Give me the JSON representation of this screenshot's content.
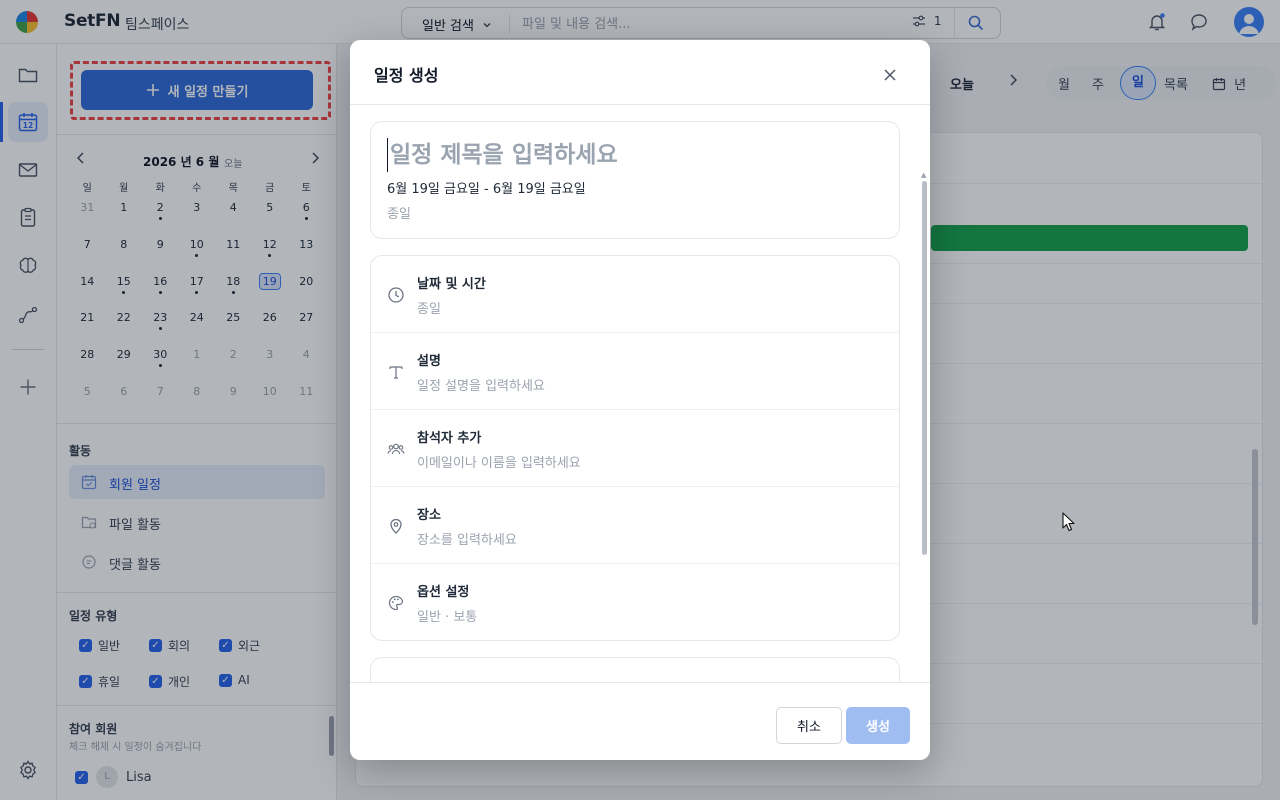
{
  "app": {
    "brand": "SetFN",
    "workspace": "팀스페이스"
  },
  "search": {
    "mode": "일반 검색",
    "placeholder": "파일 및 내용 검색...",
    "filter_count": "1"
  },
  "rail": {
    "items": [
      "folder-icon",
      "calendar-icon",
      "mail-icon",
      "clipboard-icon",
      "brain-icon",
      "flow-icon",
      "plus-icon",
      "settings-icon"
    ],
    "calendar_badge": "12"
  },
  "sidebar": {
    "create_button": "새 일정 만들기",
    "calendar": {
      "title": "2026 년 6 월",
      "today": "오늘",
      "weekdays": [
        "일",
        "월",
        "화",
        "수",
        "목",
        "금",
        "토"
      ],
      "days": [
        {
          "d": "31",
          "m": true
        },
        {
          "d": "1"
        },
        {
          "d": "2",
          "dot": true
        },
        {
          "d": "3"
        },
        {
          "d": "4"
        },
        {
          "d": "5"
        },
        {
          "d": "6",
          "dot": true
        },
        {
          "d": "7"
        },
        {
          "d": "8"
        },
        {
          "d": "9"
        },
        {
          "d": "10",
          "dot": true
        },
        {
          "d": "11"
        },
        {
          "d": "12",
          "dot": true
        },
        {
          "d": "13"
        },
        {
          "d": "14"
        },
        {
          "d": "15",
          "dot": true
        },
        {
          "d": "16",
          "dot": true
        },
        {
          "d": "17",
          "dot": true
        },
        {
          "d": "18",
          "dot": true
        },
        {
          "d": "19",
          "sel": true
        },
        {
          "d": "20"
        },
        {
          "d": "21"
        },
        {
          "d": "22"
        },
        {
          "d": "23",
          "dot": true
        },
        {
          "d": "24"
        },
        {
          "d": "25"
        },
        {
          "d": "26"
        },
        {
          "d": "27"
        },
        {
          "d": "28"
        },
        {
          "d": "29"
        },
        {
          "d": "30",
          "dot": true
        },
        {
          "d": "1",
          "m": true
        },
        {
          "d": "2",
          "m": true
        },
        {
          "d": "3",
          "m": true
        },
        {
          "d": "4",
          "m": true
        },
        {
          "d": "5",
          "m": true
        },
        {
          "d": "6",
          "m": true
        },
        {
          "d": "7",
          "m": true
        },
        {
          "d": "8",
          "m": true
        },
        {
          "d": "9",
          "m": true
        },
        {
          "d": "10",
          "m": true
        },
        {
          "d": "11",
          "m": true
        }
      ]
    },
    "activity_title": "활동",
    "activities": [
      "회원 일정",
      "파일 활동",
      "댓글 활동"
    ],
    "types_title": "일정 유형",
    "types": [
      "일반",
      "회의",
      "외근",
      "휴일",
      "개인",
      "AI"
    ],
    "members_title": "참여 회원",
    "members_sub": "체크 해제 시 일정이 숨겨집니다",
    "member": {
      "initial": "L",
      "name": "Lisa"
    }
  },
  "main": {
    "today": "오늘",
    "views": [
      "월",
      "주",
      "일",
      "목록",
      "년"
    ],
    "active_view": "일"
  },
  "modal": {
    "title": "일정 생성",
    "title_placeholder": "일정 제목을 입력하세요",
    "date_range": "6월 19일 금요일 - 6월 19일 금요일",
    "all_day": "종일",
    "options": [
      {
        "title": "날짜 및 시간",
        "sub": "종일",
        "icon": "clock-icon"
      },
      {
        "title": "설명",
        "sub": "일정 설명을 입력하세요",
        "icon": "text-icon"
      },
      {
        "title": "참석자 추가",
        "sub": "이메일이나 이름을 입력하세요",
        "icon": "people-icon"
      },
      {
        "title": "장소",
        "sub": "장소를 입력하세요",
        "icon": "location-icon"
      },
      {
        "title": "옵션 설정",
        "sub": "일반 · 보통",
        "icon": "palette-icon"
      }
    ],
    "cancel": "취소",
    "create": "생성"
  },
  "colors": {
    "accent": "#2f6bd8",
    "event_green": "#16a34a",
    "highlight_red": "#ef4444"
  }
}
